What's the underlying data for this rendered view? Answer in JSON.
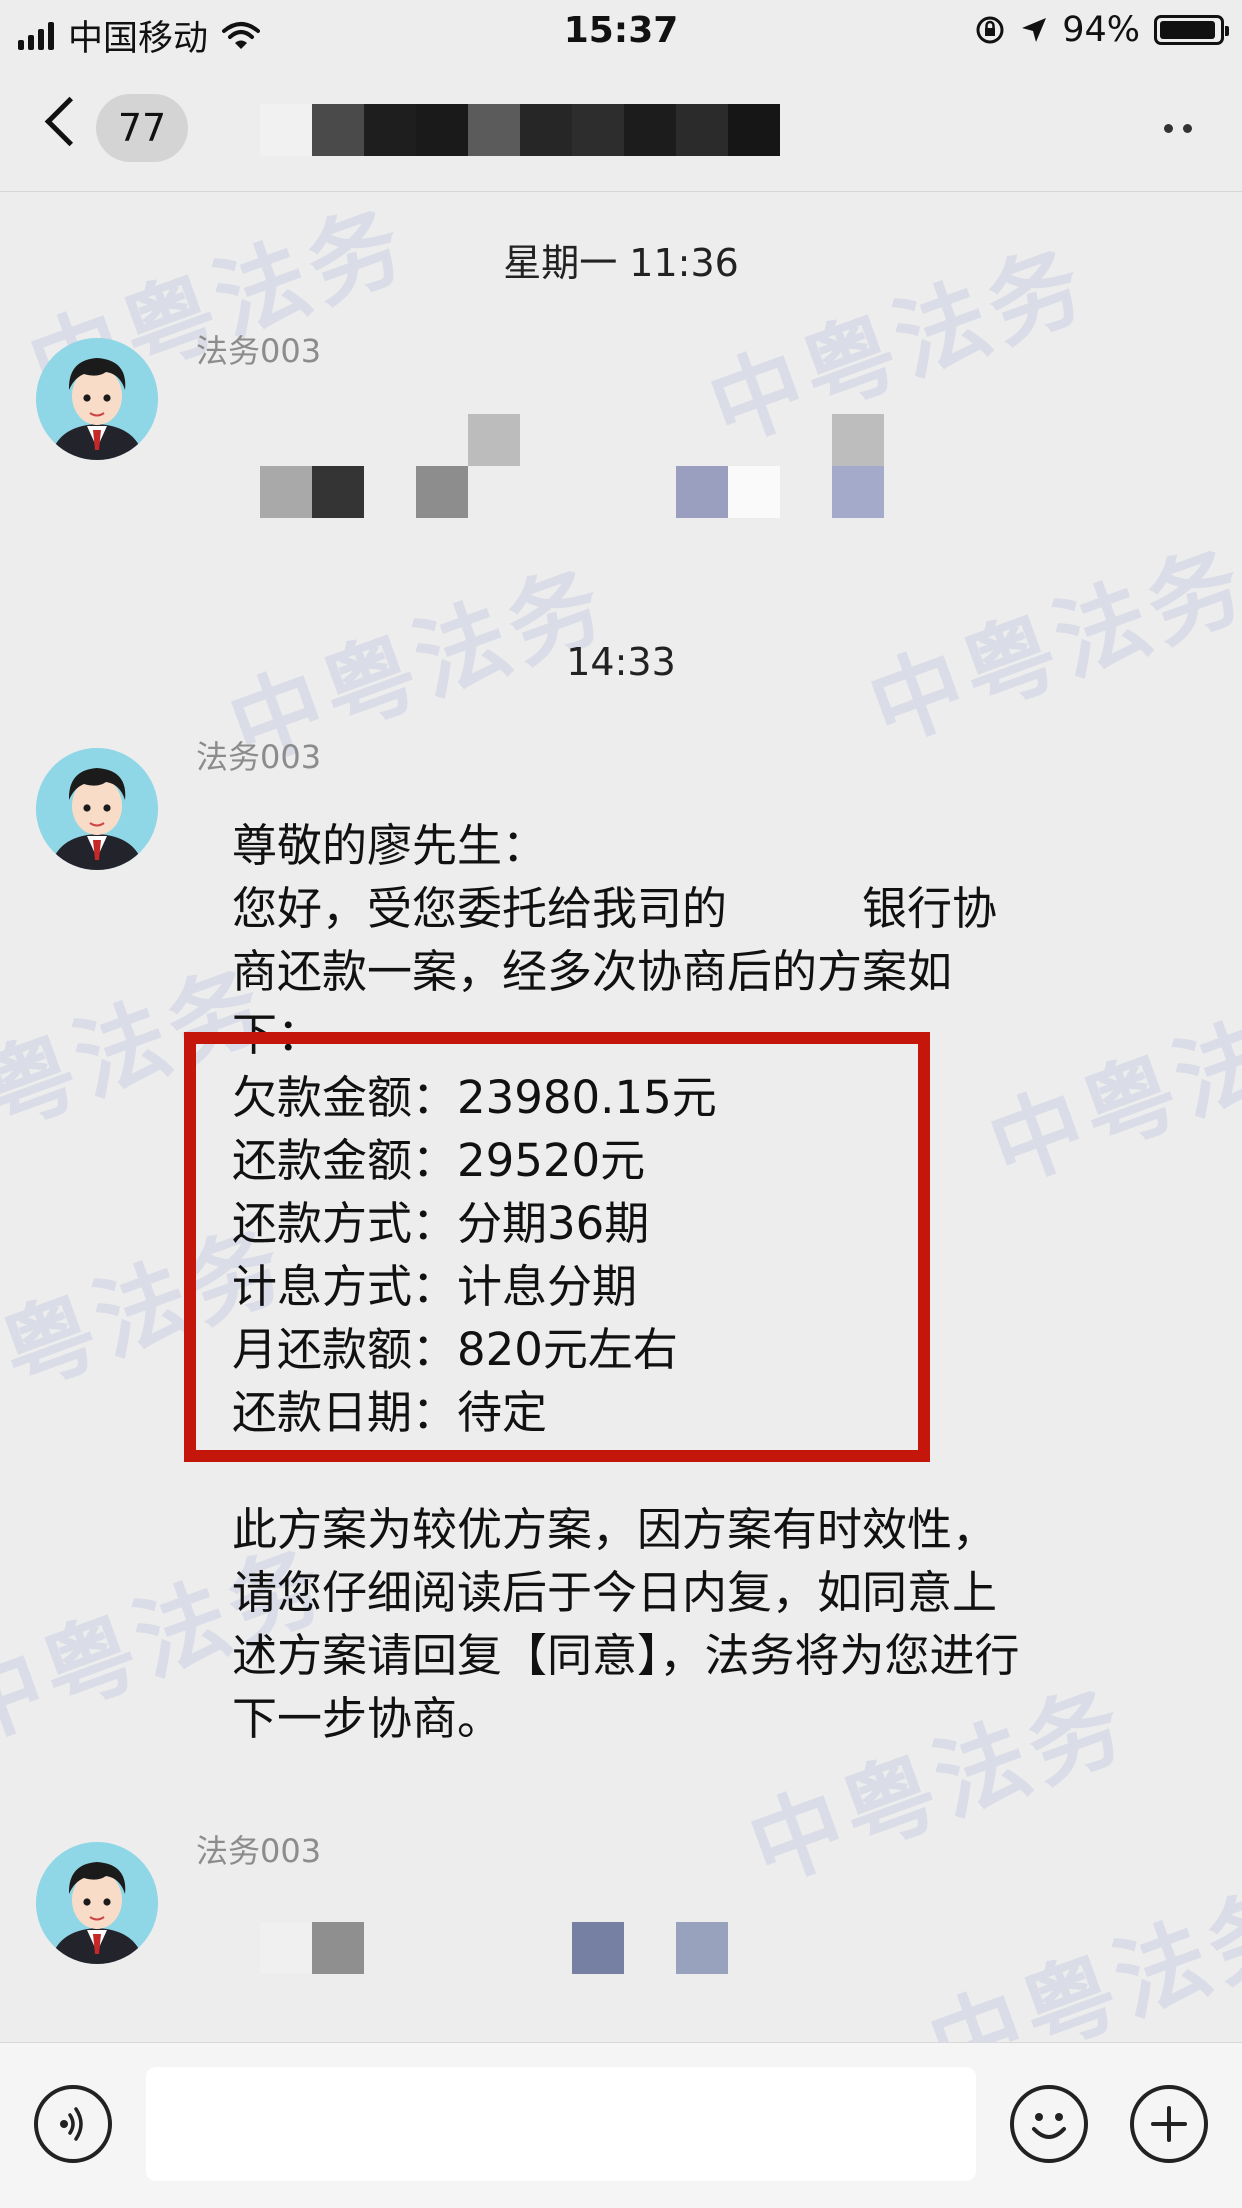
{
  "status_bar": {
    "carrier": "中国移动",
    "time": "15:37",
    "battery": "94%",
    "battery_level": 0.94,
    "icons": [
      "signal-icon",
      "wifi-icon",
      "rotation-lock-icon",
      "location-arrow-icon",
      "battery-icon"
    ]
  },
  "nav": {
    "unread_count": "77",
    "icons": [
      "back-chevron-icon",
      "more-dots-icon"
    ]
  },
  "watermark_text": "中粤法务",
  "messages": [
    {
      "timestamp": "星期一 11:36",
      "sender": "法务003",
      "content_obscured": true
    },
    {
      "timestamp": "14:33",
      "sender": "法务003",
      "greeting": "尊敬的廖先生：",
      "intro": "您好，受您委托给我司的　　　银行协商还款一案，经多次协商后的方案如下：",
      "details": [
        {
          "label": "欠款金额：",
          "value": "23980.15元"
        },
        {
          "label": "还款金额：",
          "value": "29520元"
        },
        {
          "label": "还款方式：",
          "value": "分期36期"
        },
        {
          "label": "计息方式：",
          "value": "计息分期"
        },
        {
          "label": "月还款额：",
          "value": "820元左右"
        },
        {
          "label": "还款日期：",
          "value": "待定"
        }
      ],
      "closing": "此方案为较优方案，因方案有时效性，请您仔细阅读后于今日内复，如同意上述方案请回复【同意】，法务将为您进行下一步协商。"
    },
    {
      "sender": "法务003",
      "content_obscured": true
    }
  ],
  "input_bar": {
    "placeholder": "",
    "icons": [
      "voice-icon",
      "emoji-icon",
      "plus-icon"
    ]
  },
  "colors": {
    "background": "#ededed",
    "highlight_border": "#c5160c",
    "watermark": "#7680c8",
    "sender_name": "#8c8c8c"
  }
}
